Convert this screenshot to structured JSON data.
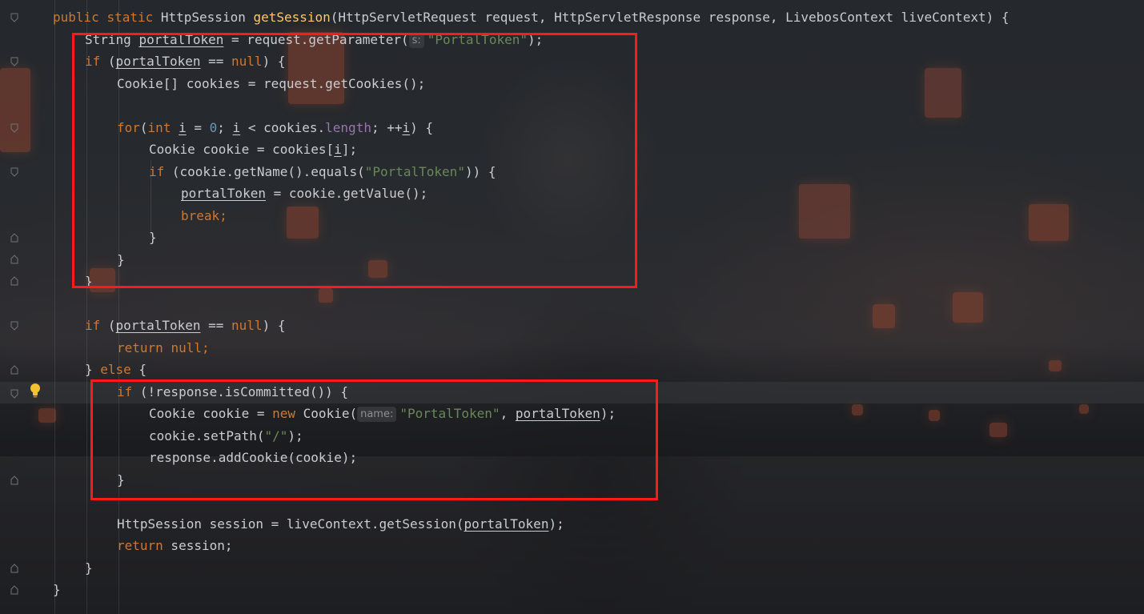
{
  "editor": {
    "colors": {
      "keyword": "#cc7832",
      "method_declaration": "#ffc66d",
      "string": "#6a8759",
      "number": "#6897bb",
      "field": "#9876aa",
      "default_text": "#c9ccd1",
      "highlight_box": "#ff1a1a"
    },
    "gutter_icons": [
      "fold-marker-icon",
      "lightbulb-icon"
    ],
    "code": {
      "l1": {
        "a": "public",
        "b": "static",
        "c": "HttpSession ",
        "d": "getSession",
        "e": "(HttpServletRequest request, HttpServletResponse response, LivebosContext liveContext) {"
      },
      "l2": {
        "a": "String ",
        "b": "portalToken",
        "c": " = request.getParameter(",
        "hint": "s:",
        "d": "\"PortalToken\"",
        "e": ");"
      },
      "l3": {
        "a": "if",
        "b": " (",
        "c": "portalToken",
        "d": " == ",
        "e": "null",
        "f": ") {"
      },
      "l4": {
        "a": "Cookie[] cookies = request.getCookies();"
      },
      "l5": {
        "a": "for",
        "b": "(",
        "c": "int",
        "d": " ",
        "e": "i",
        "f": " = ",
        "g": "0",
        "h": "; ",
        "i": "i",
        "j": " < cookies.",
        "k": "length",
        "l": "; ++",
        "m": "i",
        "n": ") {"
      },
      "l6": {
        "a": "Cookie cookie = cookies[",
        "b": "i",
        "c": "];"
      },
      "l7": {
        "a": "if",
        "b": " (cookie.getName().equals(",
        "c": "\"PortalToken\"",
        "d": ")) {"
      },
      "l8": {
        "a": "portalToken",
        "b": " = cookie.getValue();"
      },
      "l9": {
        "a": "break",
        "b": ";"
      },
      "l10": {
        "a": "}"
      },
      "l11": {
        "a": "}"
      },
      "l12": {
        "a": "}"
      },
      "l13": {
        "a": "if",
        "b": " (",
        "c": "portalToken",
        "d": " == ",
        "e": "null",
        "f": ") {"
      },
      "l14": {
        "a": "return",
        "b": " ",
        "c": "null",
        "d": ";"
      },
      "l15": {
        "a": "} ",
        "b": "else",
        "c": " {"
      },
      "l16": {
        "a": "if",
        "b": " (!response.isCommitted()) {"
      },
      "l17": {
        "a": "Cookie cookie = ",
        "b": "new",
        "c": " Cookie(",
        "hint": "name:",
        "d": "\"PortalToken\"",
        "e": ", ",
        "f": "portalToken",
        "g": ");"
      },
      "l18": {
        "a": "cookie.setPath(",
        "b": "\"/\"",
        "c": ");"
      },
      "l19": {
        "a": "response.addCookie(cookie);"
      },
      "l20": {
        "a": "}"
      },
      "l21": {
        "a": "HttpSession session = liveContext.getSession(",
        "b": "portalToken",
        "c": ");"
      },
      "l22": {
        "a": "return",
        "b": " session;"
      },
      "l23": {
        "a": "}"
      },
      "l24": {
        "a": "}"
      }
    }
  }
}
